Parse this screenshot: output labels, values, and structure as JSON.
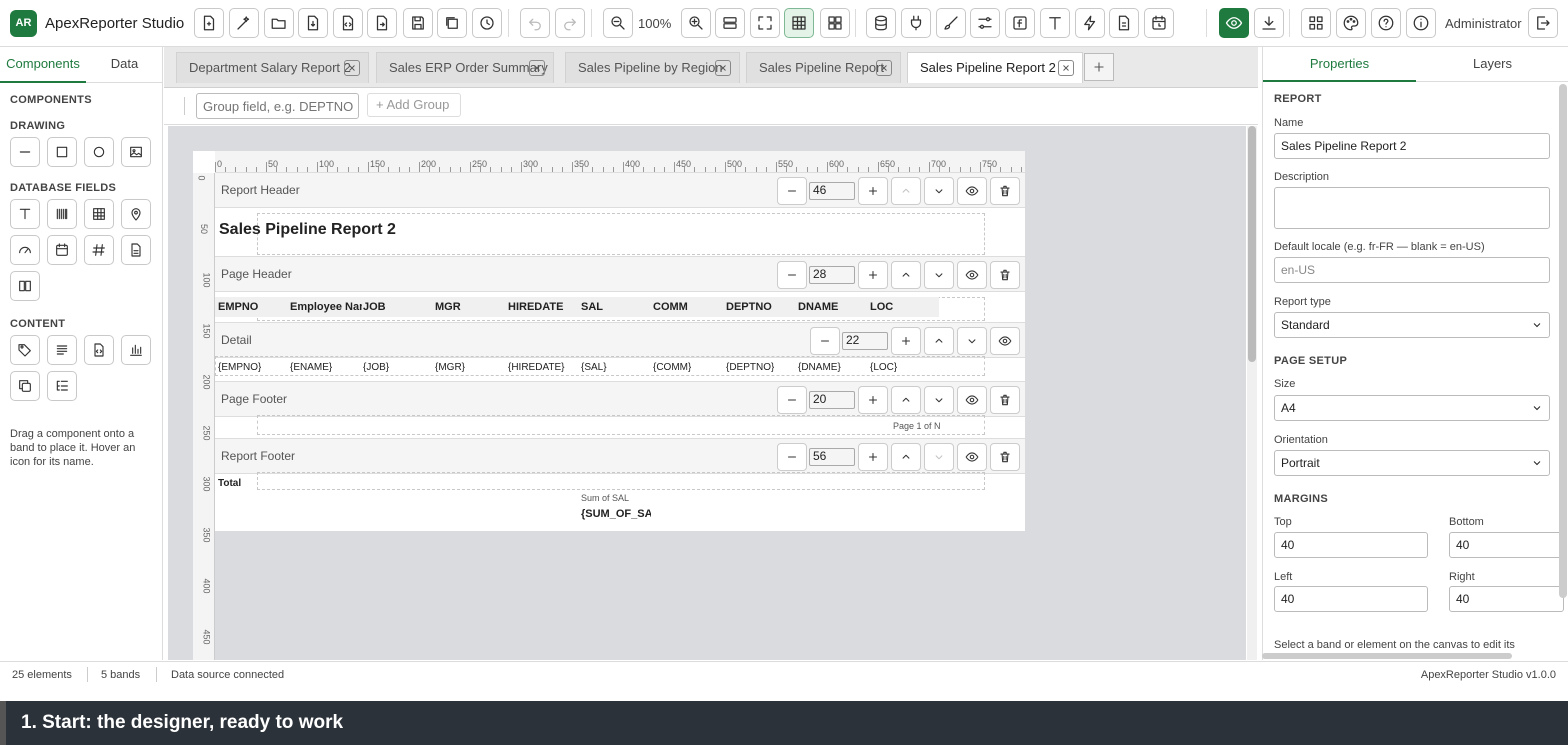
{
  "app": {
    "logo": "AR",
    "title": "ApexReporter Studio",
    "zoom": "100%",
    "user": "Administrator"
  },
  "toolbar": {
    "icons": [
      "new-report-icon",
      "magic-wand-icon",
      "open-folder-icon",
      "import-icon",
      "code-icon",
      "export-icon",
      "save-icon",
      "save-as-icon",
      "history-icon",
      "undo-icon",
      "redo-icon",
      "zoom-out-icon",
      "zoom-in-icon",
      "bands-icon",
      "fit-screen-icon",
      "grid-icon",
      "layout-icon",
      "database-icon",
      "plug-icon",
      "brush-icon",
      "sliders-icon",
      "function-icon",
      "text-icon",
      "flash-icon",
      "script-icon",
      "schedule-icon",
      "preview-icon",
      "download-icon",
      "apps-icon",
      "theme-icon",
      "help-icon",
      "info-icon",
      "logout-icon"
    ]
  },
  "left": {
    "tabs": [
      "Components",
      "Data"
    ],
    "heading": "COMPONENTS",
    "sections": [
      "DRAWING",
      "DATABASE FIELDS",
      "CONTENT"
    ],
    "drawing": [
      "line-icon",
      "rectangle-icon",
      "ellipse-icon",
      "image-icon"
    ],
    "database": [
      "text-field-icon",
      "barcode-icon",
      "table-icon",
      "map-pin-icon",
      "gauge-icon",
      "calendar-icon",
      "number-icon",
      "document-icon",
      "book-icon"
    ],
    "content": [
      "label-icon",
      "paragraph-icon",
      "html-icon",
      "chart-icon",
      "copy-icon",
      "tree-icon"
    ],
    "hint": "Drag a component onto a band to place it. Hover an icon for its name."
  },
  "tabs": [
    {
      "label": "Department Salary Report 2",
      "active": false
    },
    {
      "label": "Sales ERP Order Summary",
      "active": false
    },
    {
      "label": "Sales Pipeline by Region",
      "active": false
    },
    {
      "label": "Sales Pipeline Report",
      "active": false
    },
    {
      "label": "Sales Pipeline Report 2",
      "active": true
    }
  ],
  "groupbar": {
    "placeholder": "Group field, e.g. DEPTNO",
    "add_label": "Add Group"
  },
  "ruler": {
    "h": [
      "0",
      "50",
      "100",
      "150",
      "200",
      "250",
      "300",
      "350",
      "400",
      "450",
      "500",
      "550",
      "600",
      "650",
      "700",
      "750"
    ],
    "v": [
      "0",
      "50",
      "100",
      "150",
      "200",
      "250",
      "300",
      "350",
      "400",
      "450"
    ]
  },
  "bands": [
    {
      "name": "Report Header",
      "height": "46",
      "up_disabled": true,
      "down_disabled": false,
      "deletable": true
    },
    {
      "name": "Page Header",
      "height": "28",
      "up_disabled": false,
      "down_disabled": false,
      "deletable": true
    },
    {
      "name": "Detail",
      "height": "22",
      "up_disabled": false,
      "down_disabled": false,
      "deletable": false
    },
    {
      "name": "Page Footer",
      "height": "20",
      "up_disabled": false,
      "down_disabled": false,
      "deletable": true
    },
    {
      "name": "Report Footer",
      "height": "56",
      "up_disabled": false,
      "down_disabled": true,
      "deletable": true
    }
  ],
  "report": {
    "title": "Sales Pipeline Report 2",
    "headers": [
      "EMPNO",
      "Employee Nan",
      "JOB",
      "MGR",
      "HIREDATE",
      "SAL",
      "COMM",
      "DEPTNO",
      "DNAME",
      "LOC"
    ],
    "fields": [
      "{EMPNO}",
      "{ENAME}",
      "{JOB}",
      "{MGR}",
      "{HIREDATE}",
      "{SAL}",
      "{COMM}",
      "{DEPTNO}",
      "{DNAME}",
      "{LOC}"
    ],
    "page_of": "Page 1 of N",
    "total": "Total",
    "sum_label": "Sum of SAL",
    "sum_field": "{SUM_OF_SA"
  },
  "status": {
    "elements": "25 elements",
    "bands": "5 bands",
    "source": "Data source connected",
    "version": "ApexReporter Studio v1.0.0"
  },
  "banner": "1. Start: the designer, ready to work",
  "properties": {
    "tabs": [
      "Properties",
      "Layers"
    ],
    "report_section": "REPORT",
    "name_label": "Name",
    "name_value": "Sales Pipeline Report 2",
    "desc_label": "Description",
    "locale_label": "Default locale (e.g. fr-FR — blank = en-US)",
    "locale_placeholder": "en-US",
    "type_label": "Report type",
    "type_value": "Standard",
    "page_section": "PAGE SETUP",
    "size_label": "Size",
    "size_value": "A4",
    "orient_label": "Orientation",
    "orient_value": "Portrait",
    "margins_section": "MARGINS",
    "top_label": "Top",
    "top_value": "40",
    "bottom_label": "Bottom",
    "bottom_value": "40",
    "left_label": "Left",
    "left_value": "40",
    "right_label": "Right",
    "right_value": "40",
    "note": "Select a band or element on the canvas to edit its"
  }
}
